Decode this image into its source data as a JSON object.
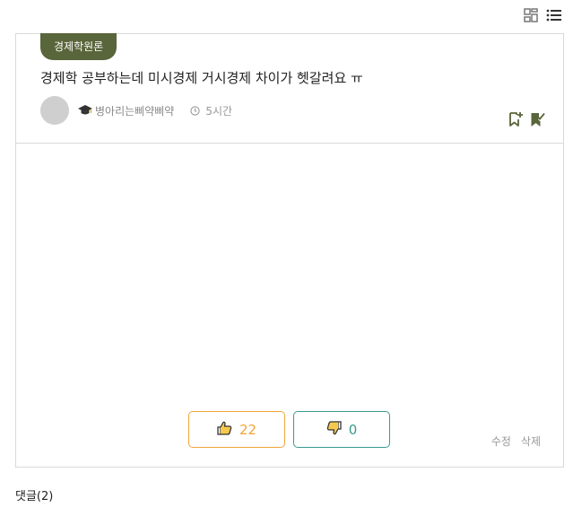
{
  "post": {
    "category": "경제학원론",
    "title": "경제학 공부하는데 미시경제 거시경제 차이가 헷갈려요 ㅠ",
    "author": "병아리는삐약삐약",
    "time": "5시간"
  },
  "votes": {
    "likes": "22",
    "dislikes": "0"
  },
  "edit_links": {
    "edit": "수정",
    "delete": "삭제"
  },
  "comments": {
    "heading": "댓글(2)"
  },
  "icons": {
    "grid_view": "grid-view-icon",
    "list_view": "list-view-icon",
    "bookmark_add": "bookmark-add-icon",
    "bookmark_check": "bookmark-check-icon",
    "clock": "clock-icon",
    "grad_cap": "graduation-cap-icon",
    "thumbs_up": "thumbs-up-icon",
    "thumbs_down": "thumbs-down-icon"
  },
  "colors": {
    "tag_bg": "#59653a",
    "like": "#f0a53a",
    "dislike": "#3a9a8c"
  }
}
